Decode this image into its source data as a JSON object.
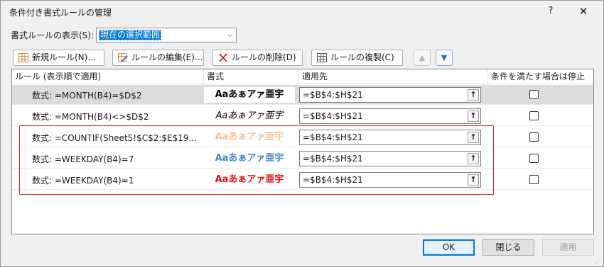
{
  "window": {
    "title": "条件付き書式ルールの管理",
    "help_label": "?",
    "close_label": "✕"
  },
  "show_rules": {
    "label": "書式ルールの表示(S):",
    "selected_value": "現在の選択範囲"
  },
  "toolbar": {
    "new_rule": "新規ルール(N)...",
    "edit_rule": "ルールの編集(E)...",
    "delete_rule": "ルールの削除(D)",
    "duplicate_rule": "ルールの複製(C)",
    "move_up": "▲",
    "move_down": "▼"
  },
  "table": {
    "headers": {
      "rule": "ルール (表示順で適用)",
      "format": "書式",
      "applies_to": "適用先",
      "stop_if_true": "条件を満たす場合は停止"
    },
    "rows": [
      {
        "rule": "数式: =MONTH(B4)=$D$2",
        "preview": "Aaあぁアァ亜宇",
        "applies_to": "=$B$4:$H$21",
        "stop": false
      },
      {
        "rule": "数式: =MONTH(B4)<>$D$2",
        "preview": "Aaあぁアァ亜宇",
        "applies_to": "=$B$4:$H$21",
        "stop": false
      },
      {
        "rule": "数式: =COUNTIF(Sheet5!$C$2:$E$19...",
        "preview": "Aaあぁアァ亜宇",
        "applies_to": "=$B$4:$H$21",
        "stop": false
      },
      {
        "rule": "数式: =WEEKDAY(B4)=7",
        "preview": "Aaあぁアァ亜宇",
        "applies_to": "=$B$4:$H$21",
        "stop": false
      },
      {
        "rule": "数式: =WEEKDAY(B4)=1",
        "preview": "Aaあぁアァ亜宇",
        "applies_to": "=$B$4:$H$21",
        "stop": false
      }
    ],
    "collapse_icon": "↑"
  },
  "footer": {
    "ok": "OK",
    "close": "閉じる",
    "apply": "適用"
  },
  "colors": {
    "selection": "#0078d7",
    "row_selected": "#dcdcdc",
    "highlight_box": "#e0201e",
    "preview_orange": "#f4c09a",
    "preview_blue": "#3c86c6",
    "preview_red": "#e01010"
  }
}
